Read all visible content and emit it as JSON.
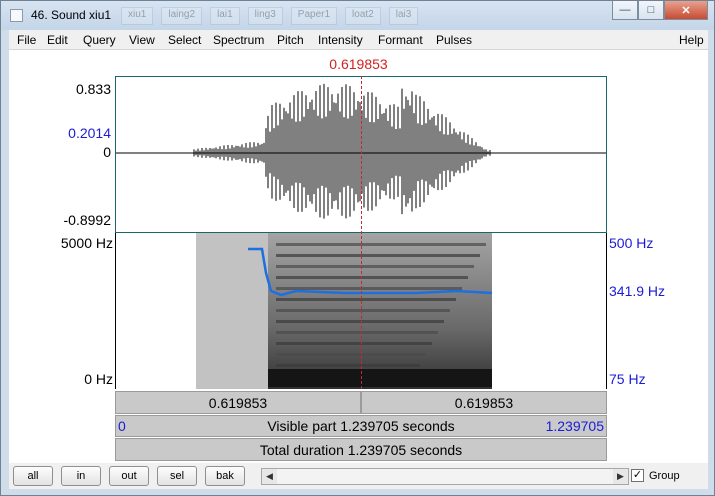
{
  "window": {
    "title": "46. Sound xiu1",
    "background_tabs": [
      "xiu1",
      "laing2",
      "lai1",
      "ling3",
      "Paper1",
      "loat2",
      "lai3"
    ]
  },
  "menu": [
    "File",
    "Edit",
    "Query",
    "View",
    "Select",
    "Spectrum",
    "Pitch",
    "Intensity",
    "Formant",
    "Pulses"
  ],
  "help_label": "Help",
  "cursor_time": "0.619853",
  "waveform": {
    "max_label": "0.833",
    "cursor_value_label": "0.2014",
    "zero_label": "0",
    "min_label": "-0.8992"
  },
  "spectrogram": {
    "top_freq_label": "5000 Hz",
    "bottom_freq_label": "0 Hz",
    "pitch_top_label": "500 Hz",
    "pitch_cursor_label": "341.9 Hz",
    "pitch_bottom_label": "75 Hz"
  },
  "info": {
    "left_time": "0.619853",
    "right_time": "0.619853",
    "visible_start": "0",
    "visible_text": "Visible part 1.239705 seconds",
    "visible_end": "1.239705",
    "total_text": "Total duration 1.239705 seconds"
  },
  "toolbar": {
    "buttons": [
      "all",
      "in",
      "out",
      "sel",
      "bak"
    ],
    "group_label": "Group",
    "group_checked": true
  },
  "colors": {
    "cursor": "#d32222",
    "pitch_line": "#1e6fe0",
    "axis_blue": "#1b1bd6"
  }
}
